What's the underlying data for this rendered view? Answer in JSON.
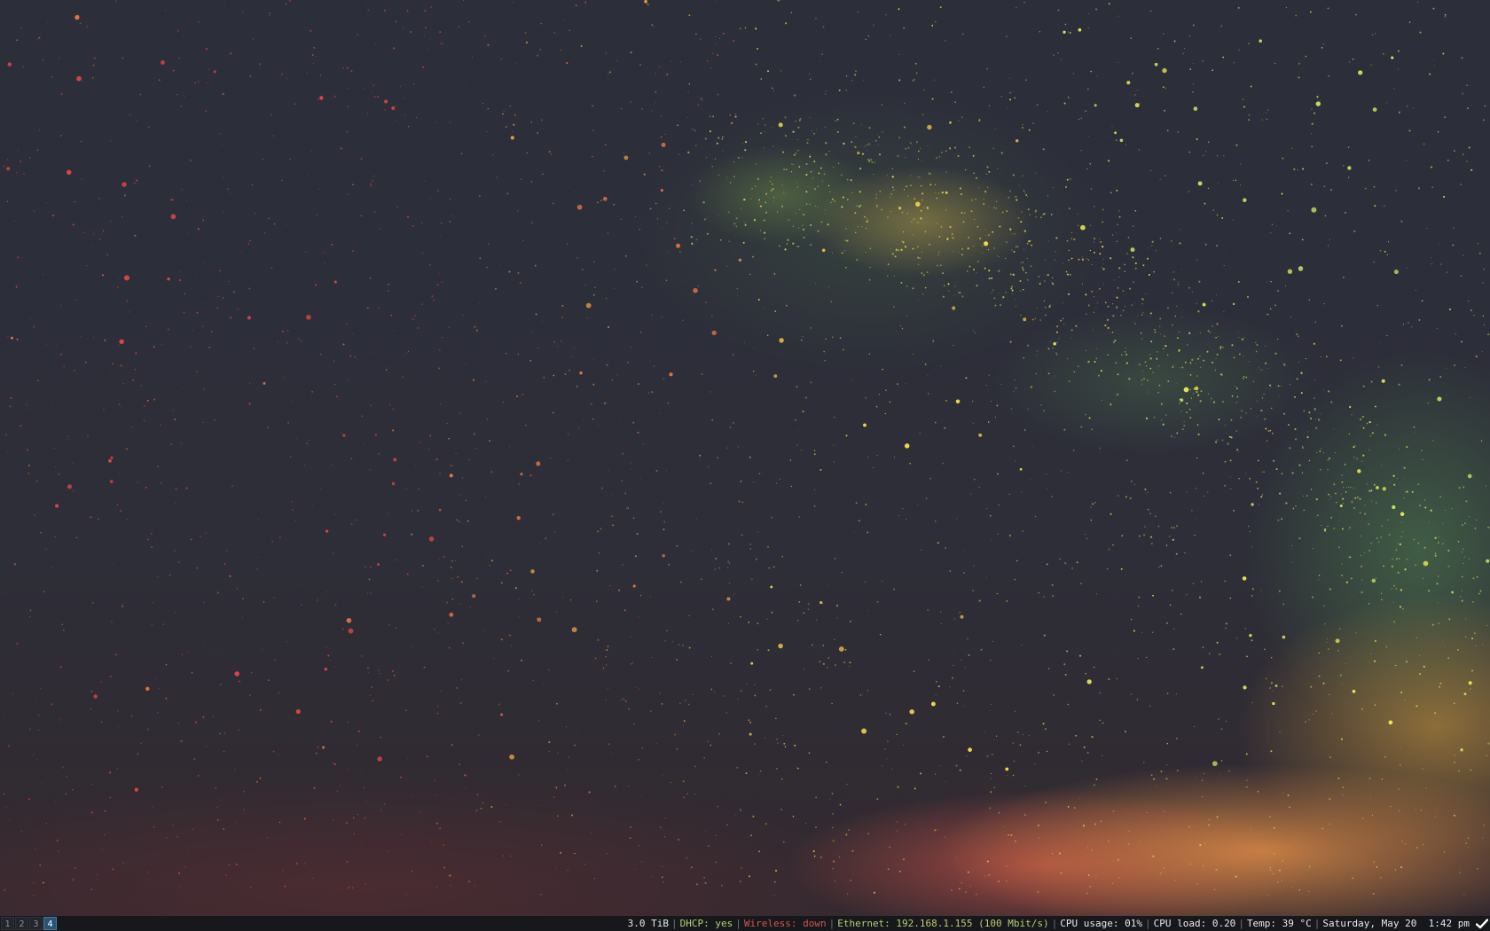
{
  "workspaces": [
    {
      "label": "1",
      "active": false
    },
    {
      "label": "2",
      "active": false
    },
    {
      "label": "3",
      "active": false
    },
    {
      "label": "4",
      "active": true
    }
  ],
  "status": {
    "disk": "3.0 TiB",
    "dhcp": "DHCP: yes",
    "wireless": "Wireless: down",
    "ethernet": "Ethernet: 192.168.1.155 (100 Mbit/s)",
    "cpu_usage": "CPU usage: 01%",
    "cpu_load": "CPU load: 0.20",
    "temp": "Temp: 39 °C",
    "datetime": "Saturday, May 20  1:42 pm",
    "separator": "|"
  },
  "tray": {
    "icon": "checkmark-icon"
  },
  "colors": {
    "good": "#b8cf6b",
    "bad": "#d9534f",
    "active_workspace": "#285577",
    "bar_background": "#16181c"
  }
}
